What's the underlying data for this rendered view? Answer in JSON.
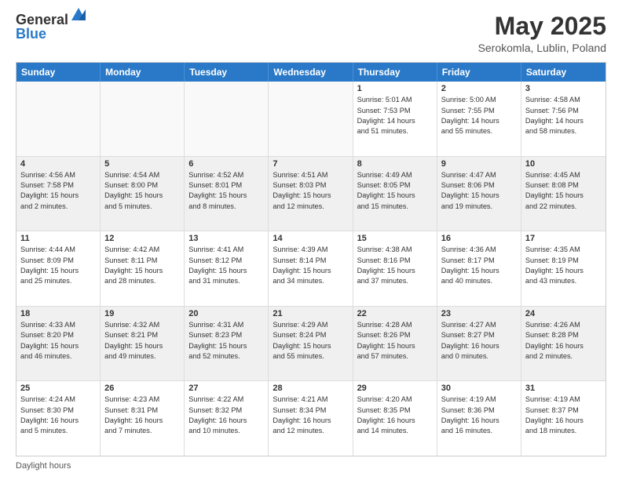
{
  "header": {
    "logo_general": "General",
    "logo_blue": "Blue",
    "month_year": "May 2025",
    "location": "Serokomla, Lublin, Poland"
  },
  "footer": {
    "label": "Daylight hours"
  },
  "day_headers": [
    "Sunday",
    "Monday",
    "Tuesday",
    "Wednesday",
    "Thursday",
    "Friday",
    "Saturday"
  ],
  "rows": [
    {
      "alt": false,
      "cells": [
        {
          "empty": true,
          "number": "",
          "info": ""
        },
        {
          "empty": true,
          "number": "",
          "info": ""
        },
        {
          "empty": true,
          "number": "",
          "info": ""
        },
        {
          "empty": true,
          "number": "",
          "info": ""
        },
        {
          "empty": false,
          "number": "1",
          "info": "Sunrise: 5:01 AM\nSunset: 7:53 PM\nDaylight: 14 hours\nand 51 minutes."
        },
        {
          "empty": false,
          "number": "2",
          "info": "Sunrise: 5:00 AM\nSunset: 7:55 PM\nDaylight: 14 hours\nand 55 minutes."
        },
        {
          "empty": false,
          "number": "3",
          "info": "Sunrise: 4:58 AM\nSunset: 7:56 PM\nDaylight: 14 hours\nand 58 minutes."
        }
      ]
    },
    {
      "alt": true,
      "cells": [
        {
          "empty": false,
          "number": "4",
          "info": "Sunrise: 4:56 AM\nSunset: 7:58 PM\nDaylight: 15 hours\nand 2 minutes."
        },
        {
          "empty": false,
          "number": "5",
          "info": "Sunrise: 4:54 AM\nSunset: 8:00 PM\nDaylight: 15 hours\nand 5 minutes."
        },
        {
          "empty": false,
          "number": "6",
          "info": "Sunrise: 4:52 AM\nSunset: 8:01 PM\nDaylight: 15 hours\nand 8 minutes."
        },
        {
          "empty": false,
          "number": "7",
          "info": "Sunrise: 4:51 AM\nSunset: 8:03 PM\nDaylight: 15 hours\nand 12 minutes."
        },
        {
          "empty": false,
          "number": "8",
          "info": "Sunrise: 4:49 AM\nSunset: 8:05 PM\nDaylight: 15 hours\nand 15 minutes."
        },
        {
          "empty": false,
          "number": "9",
          "info": "Sunrise: 4:47 AM\nSunset: 8:06 PM\nDaylight: 15 hours\nand 19 minutes."
        },
        {
          "empty": false,
          "number": "10",
          "info": "Sunrise: 4:45 AM\nSunset: 8:08 PM\nDaylight: 15 hours\nand 22 minutes."
        }
      ]
    },
    {
      "alt": false,
      "cells": [
        {
          "empty": false,
          "number": "11",
          "info": "Sunrise: 4:44 AM\nSunset: 8:09 PM\nDaylight: 15 hours\nand 25 minutes."
        },
        {
          "empty": false,
          "number": "12",
          "info": "Sunrise: 4:42 AM\nSunset: 8:11 PM\nDaylight: 15 hours\nand 28 minutes."
        },
        {
          "empty": false,
          "number": "13",
          "info": "Sunrise: 4:41 AM\nSunset: 8:12 PM\nDaylight: 15 hours\nand 31 minutes."
        },
        {
          "empty": false,
          "number": "14",
          "info": "Sunrise: 4:39 AM\nSunset: 8:14 PM\nDaylight: 15 hours\nand 34 minutes."
        },
        {
          "empty": false,
          "number": "15",
          "info": "Sunrise: 4:38 AM\nSunset: 8:16 PM\nDaylight: 15 hours\nand 37 minutes."
        },
        {
          "empty": false,
          "number": "16",
          "info": "Sunrise: 4:36 AM\nSunset: 8:17 PM\nDaylight: 15 hours\nand 40 minutes."
        },
        {
          "empty": false,
          "number": "17",
          "info": "Sunrise: 4:35 AM\nSunset: 8:19 PM\nDaylight: 15 hours\nand 43 minutes."
        }
      ]
    },
    {
      "alt": true,
      "cells": [
        {
          "empty": false,
          "number": "18",
          "info": "Sunrise: 4:33 AM\nSunset: 8:20 PM\nDaylight: 15 hours\nand 46 minutes."
        },
        {
          "empty": false,
          "number": "19",
          "info": "Sunrise: 4:32 AM\nSunset: 8:21 PM\nDaylight: 15 hours\nand 49 minutes."
        },
        {
          "empty": false,
          "number": "20",
          "info": "Sunrise: 4:31 AM\nSunset: 8:23 PM\nDaylight: 15 hours\nand 52 minutes."
        },
        {
          "empty": false,
          "number": "21",
          "info": "Sunrise: 4:29 AM\nSunset: 8:24 PM\nDaylight: 15 hours\nand 55 minutes."
        },
        {
          "empty": false,
          "number": "22",
          "info": "Sunrise: 4:28 AM\nSunset: 8:26 PM\nDaylight: 15 hours\nand 57 minutes."
        },
        {
          "empty": false,
          "number": "23",
          "info": "Sunrise: 4:27 AM\nSunset: 8:27 PM\nDaylight: 16 hours\nand 0 minutes."
        },
        {
          "empty": false,
          "number": "24",
          "info": "Sunrise: 4:26 AM\nSunset: 8:28 PM\nDaylight: 16 hours\nand 2 minutes."
        }
      ]
    },
    {
      "alt": false,
      "cells": [
        {
          "empty": false,
          "number": "25",
          "info": "Sunrise: 4:24 AM\nSunset: 8:30 PM\nDaylight: 16 hours\nand 5 minutes."
        },
        {
          "empty": false,
          "number": "26",
          "info": "Sunrise: 4:23 AM\nSunset: 8:31 PM\nDaylight: 16 hours\nand 7 minutes."
        },
        {
          "empty": false,
          "number": "27",
          "info": "Sunrise: 4:22 AM\nSunset: 8:32 PM\nDaylight: 16 hours\nand 10 minutes."
        },
        {
          "empty": false,
          "number": "28",
          "info": "Sunrise: 4:21 AM\nSunset: 8:34 PM\nDaylight: 16 hours\nand 12 minutes."
        },
        {
          "empty": false,
          "number": "29",
          "info": "Sunrise: 4:20 AM\nSunset: 8:35 PM\nDaylight: 16 hours\nand 14 minutes."
        },
        {
          "empty": false,
          "number": "30",
          "info": "Sunrise: 4:19 AM\nSunset: 8:36 PM\nDaylight: 16 hours\nand 16 minutes."
        },
        {
          "empty": false,
          "number": "31",
          "info": "Sunrise: 4:19 AM\nSunset: 8:37 PM\nDaylight: 16 hours\nand 18 minutes."
        }
      ]
    }
  ]
}
